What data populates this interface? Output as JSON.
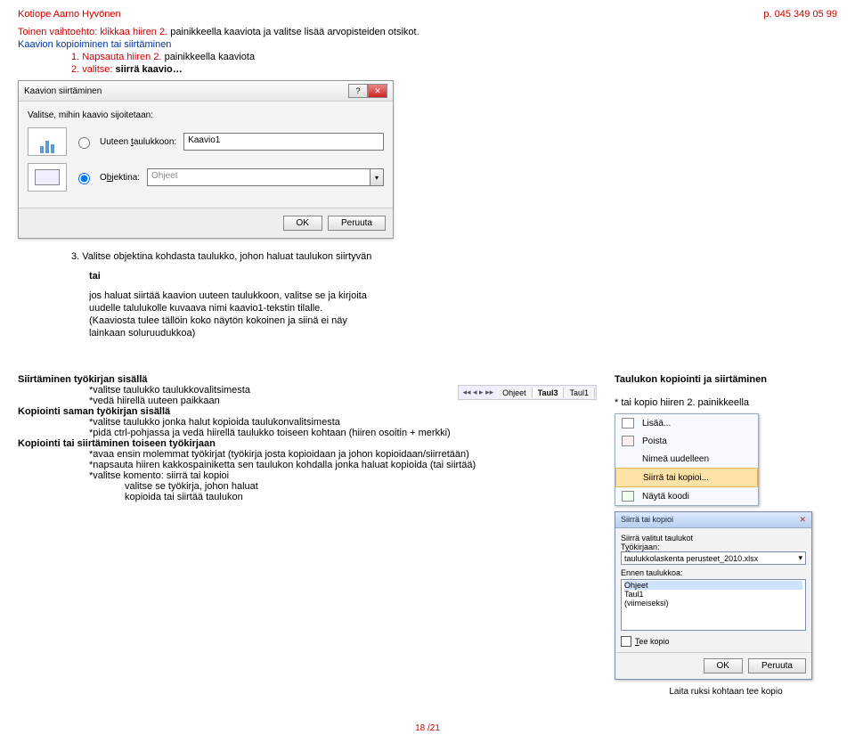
{
  "header": {
    "left": "Kotiope Aarno Hyvönen",
    "right": "p. 045 349 05 99"
  },
  "intro": {
    "line1_a": "Toinen vaihtoehto: klikkaa hiiren 2.",
    "line1_b": " painikkeella kaaviota ja valitse lisää arvopisteiden otsikot.",
    "heading": "Kaavion kopioiminen tai siirtäminen",
    "step1_a": "1. Napsauta hiiren 2.",
    "step1_b": " painikkeella kaaviota",
    "step2_a": "2. valitse: ",
    "step2_b": "siirrä kaavio…"
  },
  "dialog1": {
    "title": "Kaavion siirtäminen",
    "prompt": "Valitse, mihin kaavio sijoitetaan:",
    "opt1_label_pre": "Uuteen ",
    "opt1_label_u": "t",
    "opt1_label_post": "aulukkoon:",
    "opt1_value": "Kaavio1",
    "opt2_label_pre": "O",
    "opt2_label_u": "b",
    "opt2_label_post": "jektina:",
    "opt2_value": "Ohjeet",
    "ok": "OK",
    "cancel": "Peruuta"
  },
  "mid": {
    "step3": "3. Valitse objektina kohdasta taulukko, johon haluat taulukon siirtyvän",
    "tai": "tai",
    "p1": "jos haluat siirtää kaavion uuteen taulukkoon, valitse se ja kirjoita",
    "p2": "uudelle talulukolle kuvaava nimi kaavio1-tekstin tilalle.",
    "p3": "(Kaaviosta tulee tällöin koko näytön kokoinen ja siinä ei näy",
    "p4": "lainkaan soluruudukkoa)"
  },
  "lower": {
    "rtitle": "Taulukon kopiointi ja siirtäminen",
    "rsub": "* tai kopio hiiren 2. painikkeella",
    "h1": "Siirtäminen työkirjan sisällä",
    "h1_b1": "*valitse taulukko taulukkovalitsimesta",
    "h1_b2": "*vedä hiirellä uuteen paikkaan",
    "h2": "Kopiointi saman  työkirjan sisällä",
    "h2_b1": "*valitse taulukko jonka halut kopioida taulukonvalitsimesta",
    "h2_b2": "*pidä ctrl-pohjassa ja vedä hiirellä taulukko toiseen kohtaan (hiiren osoitin + merkki)",
    "h3": "Kopiointi tai  siirtäminen toiseen työkirjaan",
    "h3_b1": "*avaa ensin molemmat työkirjat (työkirja josta kopioidaan ja johon kopioidaan/siirretään)",
    "h3_b2": "*napsauta hiiren kakkospainiketta sen taulukon kohdalla jonka haluat kopioida (tai siirtää)",
    "h3_b3": "*valitse komento: siirrä tai kopioi",
    "h3_b4a": "valitse se työkirja, johon haluat",
    "h3_b4b": "kopioida tai siirtää taulukon"
  },
  "tabs": {
    "arrows": "◂◂ ◂ ▸ ▸▸",
    "t1": "Ohjeet",
    "t2": "Taul3",
    "t3": "Taul1"
  },
  "ctx": {
    "m1": "Lisää...",
    "m2": "Poista",
    "m3": "Nimeä uudelleen",
    "m4": "Siirrä tai kopioi...",
    "m5": "Näytä koodi"
  },
  "dialog2": {
    "title": "Siirrä tai kopioi",
    "lbl1": "Siirrä valitut taulukot",
    "lbl2_pre": "T",
    "lbl2_u": "y",
    "lbl2_post": "ökirjaan:",
    "combo": "taulukkolaskenta perusteet_2010.xlsx",
    "lbl3": "Ennen taulukkoa:",
    "li1": "Ohjeet",
    "li2": "Taul1",
    "li3": "(viimeiseksi)",
    "chk": "Tee kopio",
    "ok": "OK",
    "cancel": "Peruuta"
  },
  "caption": "Laita ruksi kohtaan tee kopio",
  "pagenum": "18 /21"
}
